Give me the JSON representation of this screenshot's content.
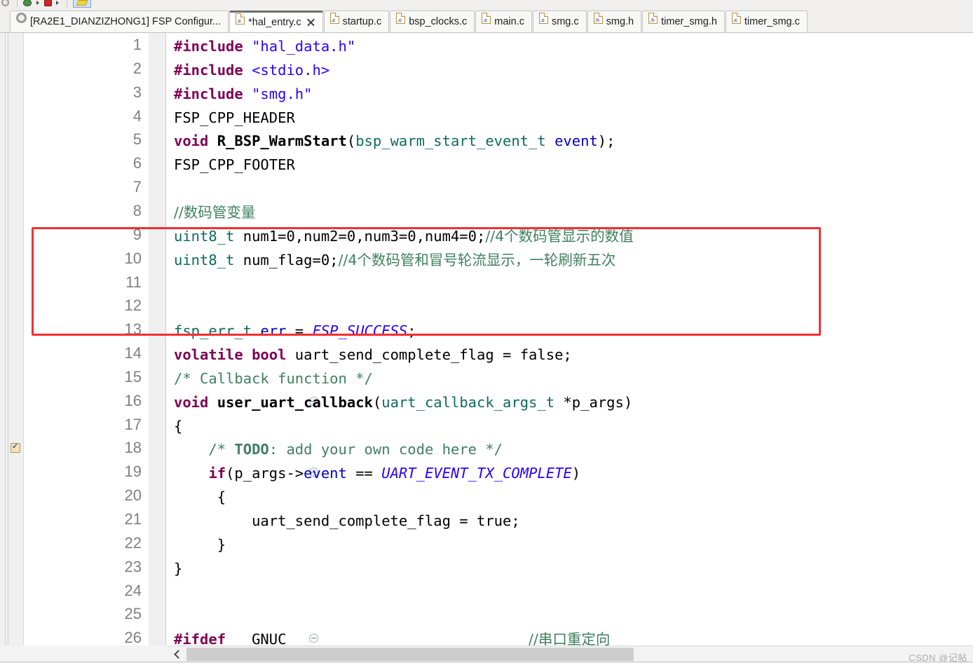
{
  "toolbar": {
    "icons": [
      "gear-icon",
      "debug-bug-icon",
      "run-stop-icon",
      "highlight-pen-icon"
    ]
  },
  "tabs": [
    {
      "label": "[RA2E1_DIANZIZHONG1] FSP Configur...",
      "icon": "gear-icon",
      "ext": "",
      "active": false,
      "closable": false
    },
    {
      "label": "*hal_entry.c",
      "icon": "c-file-icon",
      "ext": ".c",
      "active": true,
      "closable": true
    },
    {
      "label": "startup.c",
      "icon": "c-file-icon",
      "ext": ".c",
      "active": false,
      "closable": false
    },
    {
      "label": "bsp_clocks.c",
      "icon": "c-file-icon",
      "ext": ".c",
      "active": false,
      "closable": false
    },
    {
      "label": "main.c",
      "icon": "c-file-icon",
      "ext": ".c",
      "active": false,
      "closable": false
    },
    {
      "label": "smg.c",
      "icon": "c-file-icon",
      "ext": ".c",
      "active": false,
      "closable": false
    },
    {
      "label": "smg.h",
      "icon": "h-file-icon",
      "ext": ".h",
      "active": false,
      "closable": false
    },
    {
      "label": "timer_smg.h",
      "icon": "h-file-icon",
      "ext": ".h",
      "active": false,
      "closable": false
    },
    {
      "label": "timer_smg.c",
      "icon": "c-file-icon",
      "ext": ".c",
      "active": false,
      "closable": false
    }
  ],
  "editor": {
    "line_numbers": [
      "1",
      "2",
      "3",
      "4",
      "5",
      "6",
      "7",
      "8",
      "9",
      "10",
      "11",
      "12",
      "13",
      "14",
      "15",
      "16",
      "17",
      "18",
      "19",
      "20",
      "21",
      "22",
      "23",
      "24",
      "25",
      "26"
    ],
    "lines": [
      "#include \"hal_data.h\"",
      "#include <stdio.h>",
      "#include \"smg.h\"",
      "FSP_CPP_HEADER",
      "void R_BSP_WarmStart(bsp_warm_start_event_t event);",
      "FSP_CPP_FOOTER",
      "",
      "//数码管变量",
      "uint8_t num1=0,num2=0,num3=0,num4=0;//4个数码管显示的数值",
      "uint8_t num_flag=0;//4个数码管和冒号轮流显示，一轮刷新五次",
      "",
      "",
      "fsp_err_t err = FSP_SUCCESS;",
      "volatile bool uart_send_complete_flag = false;",
      "/* Callback function */",
      "void user_uart_callback(uart_callback_args_t *p_args)",
      "{",
      "    /* TODO: add your own code here */",
      "    if(p_args->event == UART_EVENT_TX_COMPLETE)",
      "     {",
      "         uart_send_complete_flag = true;",
      "     }",
      "}",
      "",
      "",
      "#ifdef __GNUC__                          //串口重定向"
    ],
    "fold_markers_on_lines": [
      16,
      19,
      26
    ],
    "todo_marker_line": 18,
    "annotation_box": {
      "label": "red-highlight-box",
      "color": "#f03030",
      "covers_lines": "8-11"
    },
    "colors": {
      "keyword": "#7f0055",
      "string": "#2a00ff",
      "comment": "#3f7f5f",
      "type": "#0d6b5e",
      "constant": "#2a00ff",
      "field": "#0000c0",
      "line_number": "#808080",
      "background": "#ffffff"
    }
  },
  "scrollbar": {
    "left_arrow": "chevron-left-icon",
    "thumb_position": "left"
  },
  "watermark": "CSDN @记帖"
}
